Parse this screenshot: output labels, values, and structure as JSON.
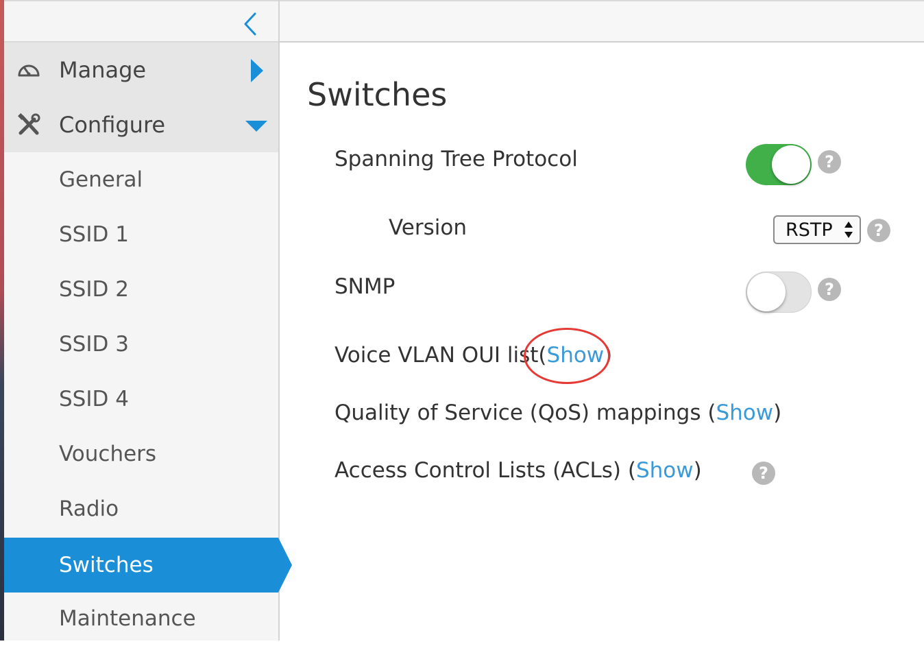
{
  "sidebar": {
    "collapse_icon": "chevron-left-icon",
    "sections": [
      {
        "label": "Manage",
        "icon": "dashboard-gauge-icon",
        "caret": "caret-right-icon",
        "expanded": false
      },
      {
        "label": "Configure",
        "icon": "tools-icon",
        "caret": "caret-down-icon",
        "expanded": true
      }
    ],
    "items": [
      {
        "label": "General"
      },
      {
        "label": "SSID 1"
      },
      {
        "label": "SSID 2"
      },
      {
        "label": "SSID 3"
      },
      {
        "label": "SSID 4"
      },
      {
        "label": "Vouchers"
      },
      {
        "label": "Radio"
      },
      {
        "label": "Switches",
        "active": true
      },
      {
        "label": "Maintenance"
      }
    ]
  },
  "main": {
    "title": "Switches",
    "stp": {
      "label": "Spanning Tree Protocol",
      "enabled": true
    },
    "version": {
      "label": "Version",
      "selected": "RSTP"
    },
    "snmp": {
      "label": "SNMP",
      "enabled": false
    },
    "voice_vlan": {
      "label": "Voice VLAN OUI list",
      "open": "(",
      "link": "Show",
      "close": ")"
    },
    "qos": {
      "label": "Quality of Service (QoS) mappings ",
      "open": "(",
      "link": "Show",
      "close": ")"
    },
    "acl": {
      "label": "Access Control Lists (ACLs) ",
      "open": "(",
      "link": "Show",
      "close": ")"
    },
    "help_glyph": "?"
  },
  "colors": {
    "accent": "#1a8fd8",
    "toggle_on": "#41b049",
    "link": "#3a9ad9",
    "annotation": "#e53935"
  }
}
